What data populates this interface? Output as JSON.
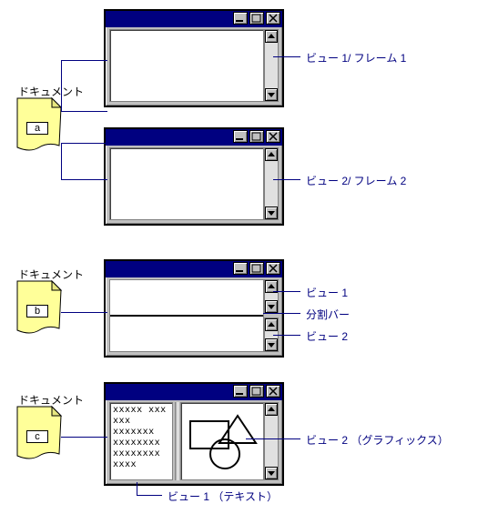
{
  "doc_title": "ドキュメント",
  "docs": {
    "a": "a",
    "b": "b",
    "c": "c"
  },
  "labels": {
    "v1f1": "ビュー 1/ フレーム 1",
    "v2f2": "ビュー 2/ フレーム 2",
    "v1": "ビュー 1",
    "split": "分割バー",
    "v2": "ビュー 2",
    "v2g": "ビュー 2 （グラフィックス）",
    "v1t": "ビュー 1 （テキスト）"
  },
  "text_lines": [
    "xxxxx xxx",
    "xxx",
    "xxxxxxx",
    "xxxxxxxx",
    "xxxxxxxx",
    "xxxx"
  ]
}
